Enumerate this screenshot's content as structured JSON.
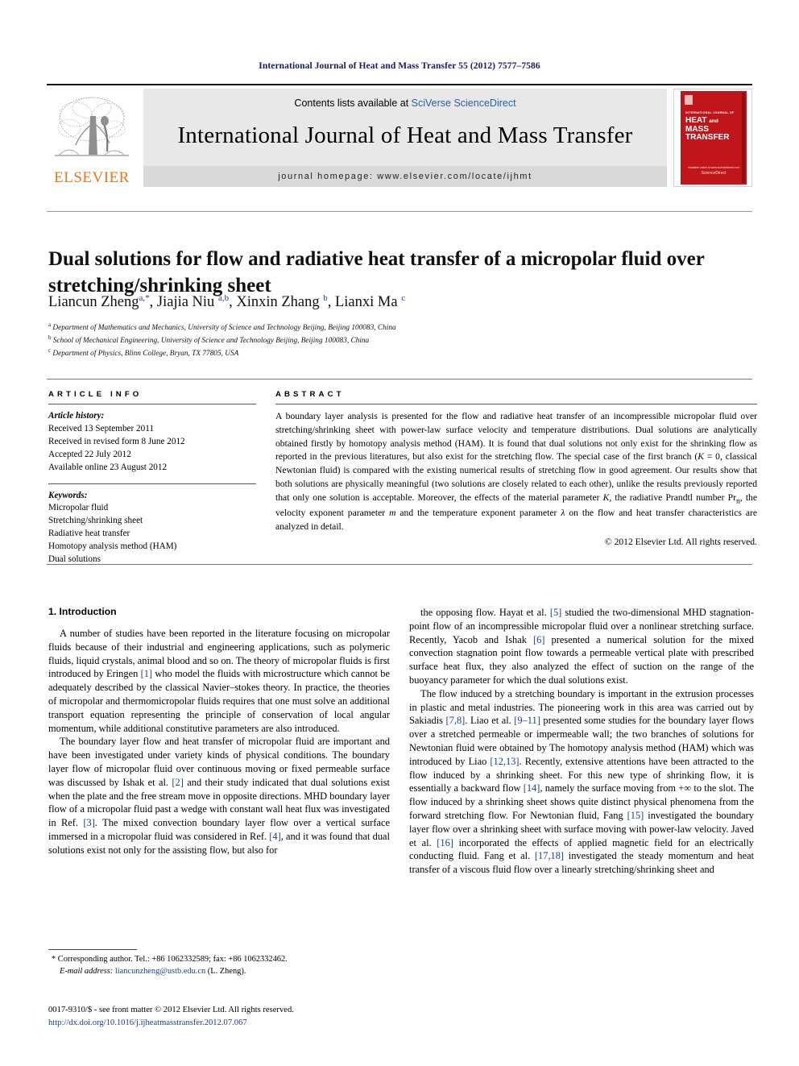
{
  "running_head": "International Journal of Heat and Mass Transfer 55 (2012) 7577–7586",
  "masthead": {
    "contents_prefix": "Contents lists available at ",
    "sciencedirect": "SciVerse ScienceDirect",
    "journal_title": "International Journal of Heat and Mass Transfer",
    "homepage": "journal homepage: www.elsevier.com/locate/ijhmt",
    "elsevier_wordmark": "ELSEVIER",
    "cover": {
      "subtitle": "INTERNATIONAL JOURNAL OF",
      "line1": "HEAT",
      "and": "and",
      "line2": "MASS",
      "line3": "TRANSFER",
      "footer_top": "Available online at www.sciencedirect.com",
      "footer_bottom": "ScienceDirect"
    }
  },
  "article": {
    "title": "Dual solutions for flow and radiative heat transfer of a micropolar fluid over stretching/shrinking sheet",
    "authors_html": "Liancun Zheng<sup>a,</sup><sup>*</sup>, Jiajia Niu <sup>a,b</sup>, Xinxin Zhang <sup>b</sup>, Lianxi Ma <sup>c</sup>",
    "affiliations": [
      {
        "mark": "a",
        "text": "Department of Mathematics and Mechanics, University of Science and Technology Beijing, Beijing 100083, China"
      },
      {
        "mark": "b",
        "text": "School of Mechanical Engineering, University of Science and Technology Beijing, Beijing 100083, China"
      },
      {
        "mark": "c",
        "text": "Department of Physics, Blinn College, Bryan, TX 77805, USA"
      }
    ]
  },
  "info": {
    "heading": "ARTICLE INFO",
    "history_label": "Article history:",
    "history": [
      "Received 13 September 2011",
      "Received in revised form 8 June 2012",
      "Accepted 22 July 2012",
      "Available online 23 August 2012"
    ],
    "keywords_label": "Keywords:",
    "keywords": [
      "Micropolar fluid",
      "Stretching/shrinking sheet",
      "Radiative heat transfer",
      "Homotopy analysis method (HAM)",
      "Dual solutions"
    ]
  },
  "abstract": {
    "heading": "ABSTRACT",
    "text_html": "A boundary layer analysis is presented for the flow and radiative heat transfer of an incompressible micropolar fluid over stretching/shrinking sheet with power-law surface velocity and temperature distributions. Dual solutions are analytically obtained firstly by homotopy analysis method (HAM). It is found that dual solutions not only exist for the shrinking flow as reported in the previous literatures, but also exist for the stretching flow. The special case of the first branch (<i>K</i> = 0, classical Newtonian fluid) is compared with the existing numerical results of stretching flow in good agreement. Our results show that both solutions are physically meaningful (two solutions are closely related to each other), unlike the results previously reported that only one solution is acceptable. Moreover, the effects of the material parameter <i>K</i>, the radiative Prandtl number Pr<sub>n</sub>, the velocity exponent parameter <i>m</i> and the temperature exponent parameter <i>&#955;</i> on the flow and heat transfer characteristics are analyzed in detail.",
    "copyright": "© 2012 Elsevier Ltd. All rights reserved."
  },
  "body": {
    "section_heading": "1. Introduction",
    "left_paragraphs_html": [
      "A number of studies have been reported in the literature focusing on micropolar fluids because of their industrial and engineering applications, such as polymeric fluids, liquid crystals, animal blood and so on. The theory of micropolar fluids is first introduced by Eringen <span class=\"ref\">[1]</span> who model the fluids with microstructure which cannot be adequately described by the classical Navier–stokes theory. In practice, the theories of micropolar and thermomicropolar fluids requires that one must solve an additional transport equation representing the principle of conservation of local angular momentum, while additional constitutive parameters are also introduced.",
      "The boundary layer flow and heat transfer of micropolar fluid are important and have been investigated under variety kinds of physical conditions. The boundary layer flow of micropolar fluid over continuous moving or fixed permeable surface was discussed by Ishak et al. <span class=\"ref\">[2]</span> and their study indicated that dual solutions exist when the plate and the free stream move in opposite directions. MHD boundary layer flow of a micropolar fluid past a wedge with constant wall heat flux was investigated in Ref. <span class=\"ref\">[3]</span>. The mixed convection boundary layer flow over a vertical surface immersed in a micropolar fluid was considered in Ref. <span class=\"ref\">[4]</span>, and it was found that dual solutions exist not only for the assisting flow, but also for"
    ],
    "right_paragraphs_html": [
      "the opposing flow. Hayat et al. <span class=\"ref\">[5]</span> studied the two-dimensional MHD stagnation-point flow of an incompressible micropolar fluid over a nonlinear stretching surface. Recently, Yacob and Ishak <span class=\"ref\">[6]</span> presented a numerical solution for the mixed convection stagnation point flow towards a permeable vertical plate with prescribed surface heat flux, they also analyzed the effect of suction on the range of the buoyancy parameter for which the dual solutions exist.",
      "The flow induced by a stretching boundary is important in the extrusion processes in plastic and metal industries. The pioneering work in this area was carried out by Sakiadis <span class=\"ref\">[7,8]</span>. Liao et al. <span class=\"ref\">[9–11]</span> presented some studies for the boundary layer flows over a stretched permeable or impermeable wall; the two branches of solutions for Newtonian fluid were obtained by The homotopy analysis method (HAM) which was introduced by Liao <span class=\"ref\">[12,13]</span>. Recently, extensive attentions have been attracted to the flow induced by a shrinking sheet. For this new type of shrinking flow, it is essentially a backward flow <span class=\"ref\">[14]</span>, namely the surface moving from +&#8734; to the slot. The flow induced by a shrinking sheet shows quite distinct physical phenomena from the forward stretching flow. For Newtonian fluid, Fang <span class=\"ref\">[15]</span> investigated the boundary layer flow over a shrinking sheet with surface moving with power-law velocity. Javed et al. <span class=\"ref\">[16]</span> incorporated the effects of applied magnetic field for an electrically conducting fluid. Fang et al. <span class=\"ref\">[17,18]</span> investigated the steady momentum and heat transfer of a viscous fluid flow over a linearly stretching/shrinking sheet and"
    ]
  },
  "footnote": {
    "corresponding_html": "* Corresponding author. Tel.: +86 1062332589; fax: +86 1062332462.",
    "email_label": "E-mail address:",
    "email": "liancunzheng@ustb.edu.cn",
    "email_owner": "(L. Zheng)."
  },
  "imprint": {
    "line1": "0017-9310/$ - see front matter © 2012 Elsevier Ltd. All rights reserved.",
    "doi": "http://dx.doi.org/10.1016/j.ijheatmasstransfer.2012.07.067"
  },
  "colors": {
    "link_blue": "#1d3f8f",
    "elsevier_orange": "#E87722",
    "cover_red": "#c0161b",
    "running_head": "#1a1a5e"
  }
}
